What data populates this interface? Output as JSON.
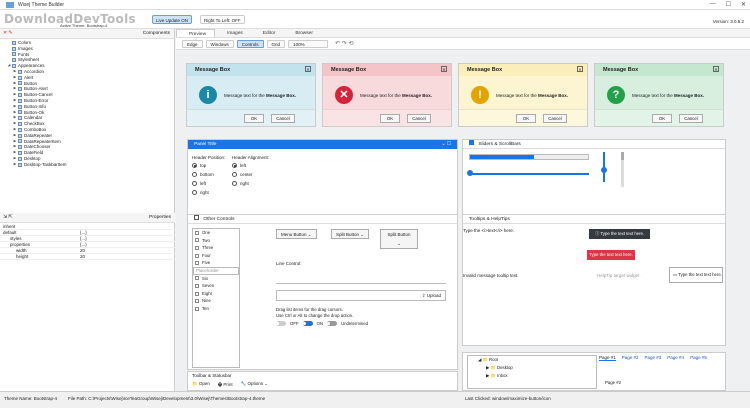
{
  "window": {
    "title": "Wisej Theme Builder",
    "version": "Version: 3.0.5.2"
  },
  "quickbar": {
    "watermark": "DownloadDevTools",
    "active_theme": "Active Theme: Bootstrap-4",
    "live_update": "Live Update ON",
    "rtl": "Right To Left: OFF"
  },
  "left": {
    "components_title": "Components",
    "tree": [
      "Colors",
      "Images",
      "Fonts",
      "Stylesheet",
      "Appearances",
      "Accordion",
      "Alert",
      "Button",
      "Button-Alert",
      "Button-Cancel",
      "Button-Error",
      "Button-Info",
      "Button-Ok",
      "Calendar",
      "CheckBox",
      "ComboBox",
      "DataRepeater",
      "DataRepeaterItem",
      "DateChooser",
      "DateField",
      "Desktop",
      "Desktop-TaskbarItem"
    ],
    "properties_title": "Properties",
    "props": [
      {
        "k": "inherit",
        "v": ""
      },
      {
        "k": "default",
        "v": "{...}"
      },
      {
        "k": "styles",
        "v": "{...}"
      },
      {
        "k": "properties",
        "v": "{...}"
      },
      {
        "k": "width",
        "v": "20"
      },
      {
        "k": "height",
        "v": "20"
      }
    ]
  },
  "tabs": [
    "Preview",
    "Images",
    "Editor",
    "Browser"
  ],
  "toolbar": {
    "edge": "Edge",
    "windows": "Windows",
    "controls": "Controls",
    "grid": "Grid",
    "zoom": "100%"
  },
  "msgboxes": [
    {
      "title": "Message Box",
      "text": "Message text for the ",
      "bold": "Message Box.",
      "ok": "OK",
      "cancel": "Cancel",
      "icon": "i",
      "color": "#d8ecf3",
      "head": "#c2e3ee",
      "circle": "#1c88a5"
    },
    {
      "title": "Message Box",
      "text": "Message text for the ",
      "bold": "Message Box.",
      "ok": "OK",
      "cancel": "Cancel",
      "icon": "✕",
      "color": "#f8dadd",
      "head": "#f3c4c8",
      "circle": "#d6233c"
    },
    {
      "title": "Message Box",
      "text": "Message text for the ",
      "bold": "Message Box.",
      "ok": "OK",
      "cancel": "Cancel",
      "icon": "!",
      "color": "#fdf4d2",
      "head": "#fbeebb",
      "circle": "#e3a300"
    },
    {
      "title": "Message Box",
      "text": "Message text for the ",
      "bold": "Message Box.",
      "ok": "OK",
      "cancel": "Cancel",
      "icon": "?",
      "color": "#d8efe0",
      "head": "#c5e7d0",
      "circle": "#22a14a"
    }
  ],
  "panel": {
    "title": "Panel Title",
    "hp_label": "Header Position:",
    "ha_label": "Header Alignment:",
    "positions": [
      "top",
      "bottom",
      "left",
      "right"
    ],
    "alignments": [
      "left",
      "center",
      "right"
    ]
  },
  "sliders": {
    "title": "Sliders & ScrollBars"
  },
  "other": {
    "title": "Other Controls",
    "list": [
      "One",
      "Two",
      "Three",
      "Four",
      "Five",
      "Six",
      "Seven",
      "Eight",
      "Nine",
      "Ten"
    ],
    "placeholder": "Placeholder",
    "menu_button": "Menu Button",
    "split_button": "Split Button",
    "split_button2": "Split Button",
    "line_control": "Line Control:",
    "upload": "Upload",
    "drag_text": "Drag list items for the drag cursors.",
    "drag_text2": "Use Ctrl or Alt to change the drop action.",
    "off": "OFF",
    "on": "ON",
    "undetermined": "Undetermined"
  },
  "tips": {
    "title": "Tooltips & HelpTips",
    "line": "Type the <i>text</i> here.",
    "dark": "Type the text text here.",
    "red": "Type the text text here.",
    "invalid": "Invalid message tooltip text.",
    "help": "HelpTip target widget.",
    "helpbox": "Type the text text here."
  },
  "toolbar2": {
    "title": "Toolbar & Statusbar",
    "open": "Open",
    "print": "Print",
    "options": "Options"
  },
  "tree2": {
    "root": "Root",
    "items": [
      "Desktop",
      "Inbox"
    ]
  },
  "pages": [
    "Page #1",
    "Page #2",
    "Page #3",
    "Page #4",
    "Page #5"
  ],
  "page_inner": "Page #2",
  "status": {
    "theme": "Theme Name: Bootstrap-4",
    "path": "File Path: C:\\Projects\\Wisej\\IceTeaGroup\\Wisej\\Development\\3.0\\Wisej\\Themes\\Bootstrap-4.theme",
    "last": "Last Clicked: window/maximize-button/icon"
  }
}
